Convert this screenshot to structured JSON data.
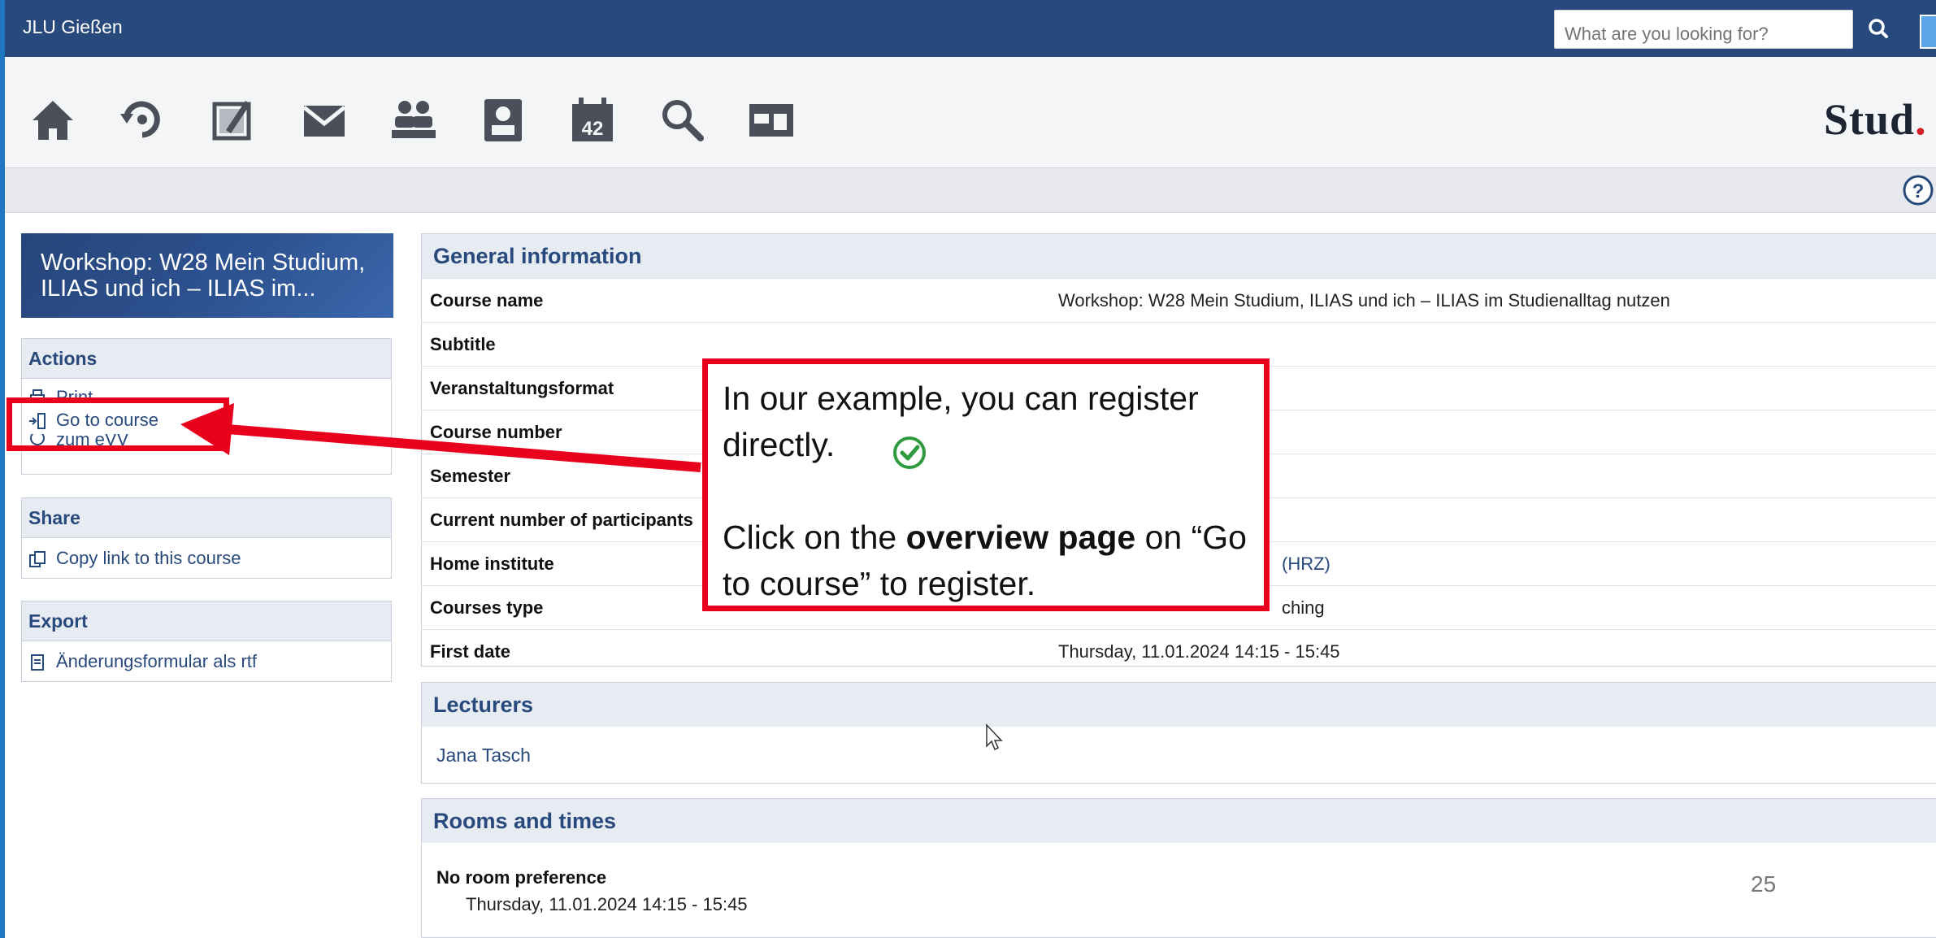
{
  "topbar": {
    "brand": "JLU Gießen",
    "search_placeholder": "What are you looking for?"
  },
  "nav": {
    "icons": [
      "home-icon",
      "activity-icon",
      "courses-icon",
      "messages-icon",
      "community-icon",
      "profile-icon",
      "planner-icon",
      "search-icon",
      "tools-icon"
    ],
    "logo_main": "Stud",
    "logo_dot": "."
  },
  "sidebar": {
    "course_title_line1": "Workshop: W28 Mein Studium,",
    "course_title_line2": "ILIAS und ich – ILIAS im...",
    "actions": {
      "heading": "Actions",
      "items": [
        "Print",
        "Go to course",
        "zum eVV"
      ]
    },
    "share": {
      "heading": "Share",
      "items": [
        "Copy link to this course"
      ]
    },
    "export": {
      "heading": "Export",
      "items": [
        "Änderungsformular als rtf"
      ]
    }
  },
  "general": {
    "heading": "General information",
    "rows": [
      {
        "label": "Course name",
        "value": "Workshop: W28 Mein Studium, ILIAS und ich – ILIAS im Studienalltag nutzen"
      },
      {
        "label": "Subtitle",
        "value": ""
      },
      {
        "label": "Veranstaltungsformat",
        "value": ""
      },
      {
        "label": "Course number",
        "value": ""
      },
      {
        "label": "Semester",
        "value": ""
      },
      {
        "label": "Current number of participants",
        "value": ""
      },
      {
        "label": "Home institute",
        "value": "(HRZ)"
      },
      {
        "label": "Courses type",
        "value": "ching"
      },
      {
        "label": "First date",
        "value": "Thursday, 11.01.2024 14:15 - 15:45"
      }
    ]
  },
  "lecturers": {
    "heading": "Lecturers",
    "name": "Jana Tasch"
  },
  "rooms": {
    "heading": "Rooms and times",
    "room": "No room preference",
    "time": "Thursday, 11.01.2024 14:15 - 15:45"
  },
  "callout": {
    "line1": "In our example, you can register directly.",
    "line2_pre": "Click on the ",
    "line2_bold": "overview page",
    "line2_post": " on “Go to course” to register."
  },
  "slide_number": "25",
  "colors": {
    "topbar": "#28497c",
    "accent_red": "#e8001c",
    "link": "#28497c"
  }
}
